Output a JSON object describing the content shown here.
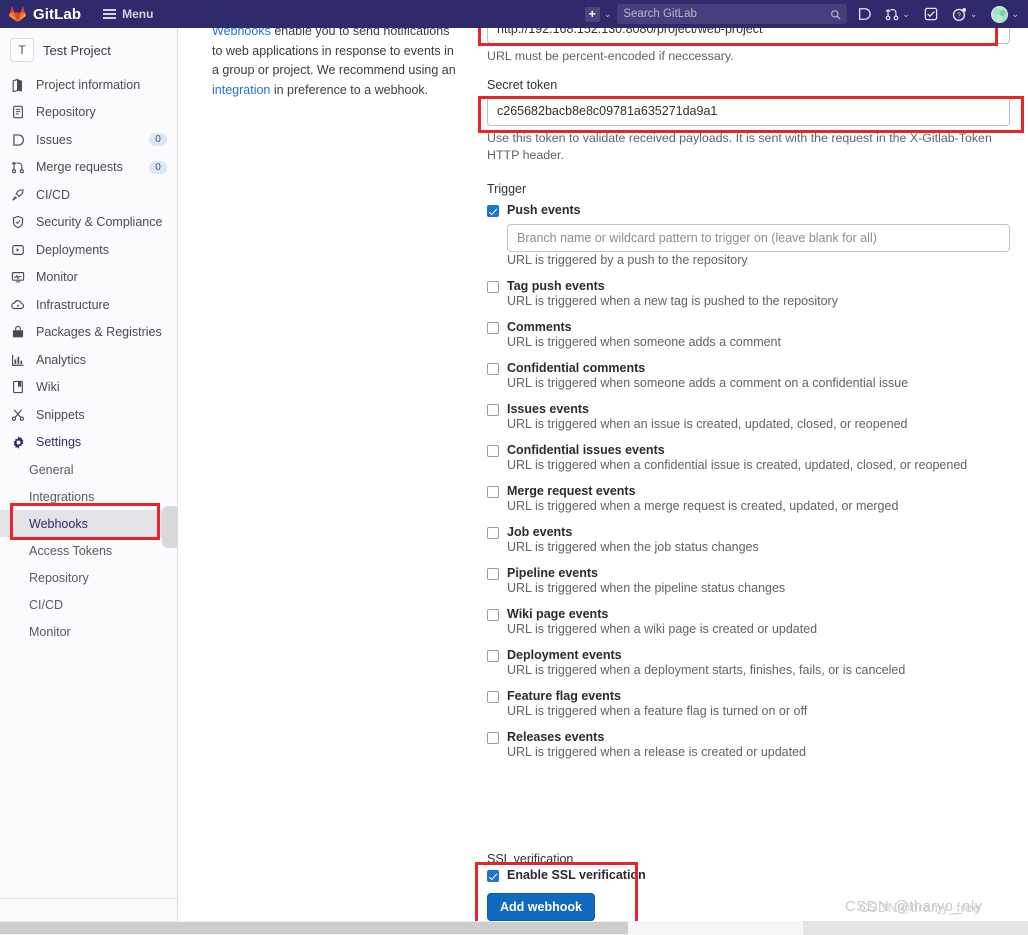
{
  "topnav": {
    "brand": "GitLab",
    "menu_label": "Menu",
    "create_icon": "plus-icon",
    "create_caret": "⌄",
    "search_placeholder": "Search GitLab",
    "search_icon": "search-icon",
    "icons": [
      {
        "name": "issues-icon",
        "glyph": "issues"
      },
      {
        "name": "merge-requests-icon",
        "glyph": "merge",
        "caret": "⌄"
      },
      {
        "name": "todos-icon",
        "glyph": "todo"
      },
      {
        "name": "help-icon",
        "glyph": "help",
        "caret": "⌄"
      },
      {
        "name": "user-avatar",
        "glyph": "avatar",
        "caret": "⌄"
      }
    ]
  },
  "sidebar": {
    "project_initial": "T",
    "project_name": "Test Project",
    "items": [
      {
        "label": "Project information",
        "icon": "project-info-icon",
        "badge": ""
      },
      {
        "label": "Repository",
        "icon": "repository-icon",
        "badge": ""
      },
      {
        "label": "Issues",
        "icon": "issues-icon",
        "badge": "0"
      },
      {
        "label": "Merge requests",
        "icon": "merge-icon",
        "badge": "0"
      },
      {
        "label": "CI/CD",
        "icon": "rocket-icon",
        "badge": ""
      },
      {
        "label": "Security & Compliance",
        "icon": "shield-icon",
        "badge": ""
      },
      {
        "label": "Deployments",
        "icon": "deployments-icon",
        "badge": ""
      },
      {
        "label": "Monitor",
        "icon": "monitor-icon",
        "badge": ""
      },
      {
        "label": "Infrastructure",
        "icon": "cloud-icon",
        "badge": ""
      },
      {
        "label": "Packages & Registries",
        "icon": "package-icon",
        "badge": ""
      },
      {
        "label": "Analytics",
        "icon": "chart-icon",
        "badge": ""
      },
      {
        "label": "Wiki",
        "icon": "book-icon",
        "badge": ""
      },
      {
        "label": "Snippets",
        "icon": "scissors-icon",
        "badge": ""
      },
      {
        "label": "Settings",
        "icon": "gear-icon",
        "badge": ""
      }
    ],
    "settings_children": [
      "General",
      "Integrations",
      "Webhooks",
      "Access Tokens",
      "Repository",
      "CI/CD",
      "Monitor"
    ],
    "current_child": "Webhooks"
  },
  "description": {
    "link_1": "Webhooks",
    "text_1": " enable you to send notifications to web applications in response to events in a group or project. We recommend using an ",
    "link_2": "integration",
    "text_2": " in preference to a webhook."
  },
  "form": {
    "url_value": "http://192.168.152.130:8080/project/web-project",
    "url_help": "URL must be percent-encoded if neccessary.",
    "secret_token_label": "Secret token",
    "secret_token_value": "c265682bacb8e8c09781a635271da9a1",
    "secret_token_help": "Use this token to validate received payloads. It is sent with the request in the X-Gitlab-Token HTTP header.",
    "trigger_label": "Trigger",
    "branch_placeholder": "Branch name or wildcard pattern to trigger on (leave blank for all)",
    "triggers": [
      {
        "label": "Push events",
        "desc": "URL is triggered by a push to the repository",
        "checked": true,
        "has_branch_input": true
      },
      {
        "label": "Tag push events",
        "desc": "URL is triggered when a new tag is pushed to the repository",
        "checked": false,
        "has_branch_input": false
      },
      {
        "label": "Comments",
        "desc": "URL is triggered when someone adds a comment",
        "checked": false,
        "has_branch_input": false
      },
      {
        "label": "Confidential comments",
        "desc": "URL is triggered when someone adds a comment on a confidential issue",
        "checked": false,
        "has_branch_input": false
      },
      {
        "label": "Issues events",
        "desc": "URL is triggered when an issue is created, updated, closed, or reopened",
        "checked": false,
        "has_branch_input": false
      },
      {
        "label": "Confidential issues events",
        "desc": "URL is triggered when a confidential issue is created, updated, closed, or reopened",
        "checked": false,
        "has_branch_input": false
      },
      {
        "label": "Merge request events",
        "desc": "URL is triggered when a merge request is created, updated, or merged",
        "checked": false,
        "has_branch_input": false
      },
      {
        "label": "Job events",
        "desc": "URL is triggered when the job status changes",
        "checked": false,
        "has_branch_input": false
      },
      {
        "label": "Pipeline events",
        "desc": "URL is triggered when the pipeline status changes",
        "checked": false,
        "has_branch_input": false
      },
      {
        "label": "Wiki page events",
        "desc": "URL is triggered when a wiki page is created or updated",
        "checked": false,
        "has_branch_input": false
      },
      {
        "label": "Deployment events",
        "desc": "URL is triggered when a deployment starts, finishes, fails, or is canceled",
        "checked": false,
        "has_branch_input": false
      },
      {
        "label": "Feature flag events",
        "desc": "URL is triggered when a feature flag is turned on or off",
        "checked": false,
        "has_branch_input": false
      },
      {
        "label": "Releases events",
        "desc": "URL is triggered when a release is created or updated",
        "checked": false,
        "has_branch_input": false
      }
    ],
    "ssl_section_label": "SSL verification",
    "ssl_checkbox_label": "Enable SSL verification",
    "ssl_checked": true,
    "submit_label": "Add webhook"
  },
  "watermark": {
    "line_1": "CSDN @tharyo_nly",
    "line_2": "CSDN@tiramy_free"
  },
  "colors": {
    "brand_purple": "#2f2a6b",
    "accent_blue": "#1f75cb",
    "button_blue": "#1068bf",
    "highlight_red": "#e8242a",
    "link_blue": "#1f75cb"
  }
}
